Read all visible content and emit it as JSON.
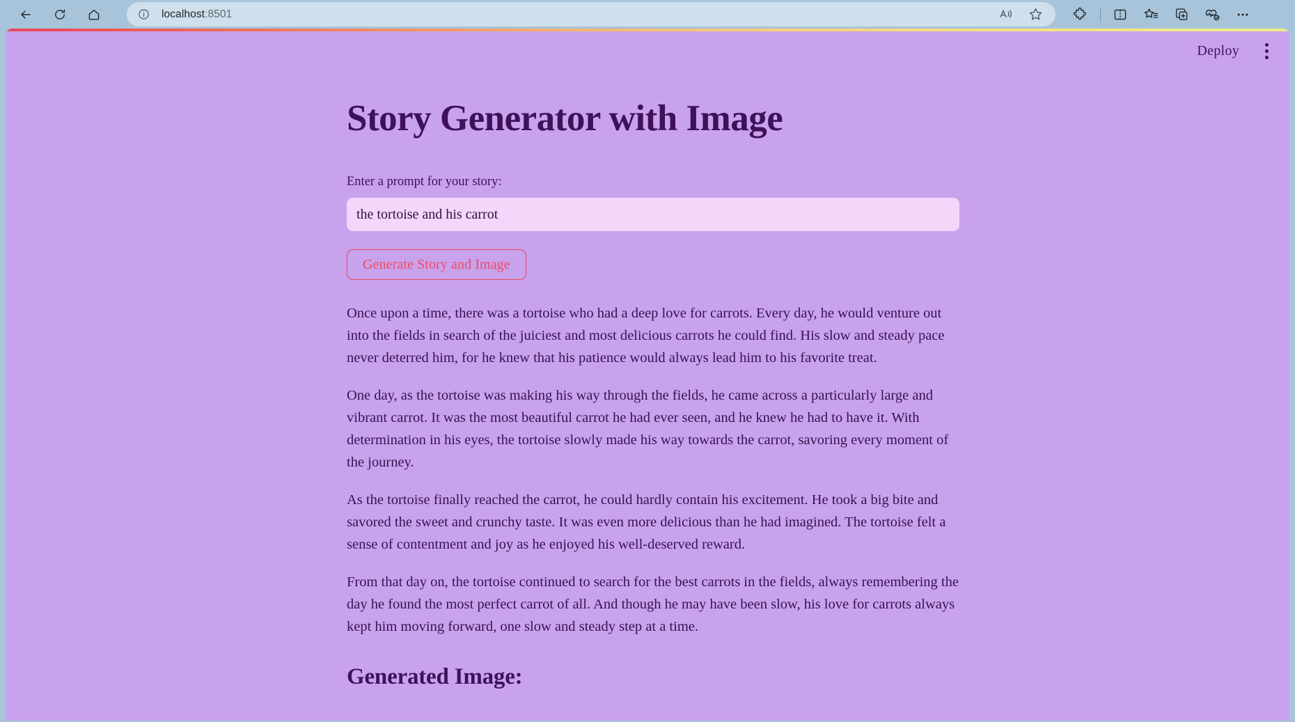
{
  "browser": {
    "back_icon": "back-arrow-icon",
    "reload_icon": "reload-icon",
    "home_icon": "home-icon",
    "site_info_icon": "site-info-icon",
    "url_host": "localhost",
    "url_port": ":8501",
    "read_aloud_icon": "read-aloud-icon",
    "favorite_icon": "star-icon",
    "extensions_icon": "puzzle-extensions-icon",
    "split_screen_icon": "split-screen-icon",
    "favorites_icon": "favorites-star-list-icon",
    "collections_icon": "collections-icon",
    "browser_essentials_icon": "browser-essentials-icon",
    "settings_icon": "ellipsis-settings-icon"
  },
  "app": {
    "deploy_label": "Deploy",
    "menu_icon": "kebab-menu-icon",
    "title": "Story Generator with Image",
    "prompt_label": "Enter a prompt for your story:",
    "prompt_value": "the tortoise and his carrot",
    "prompt_placeholder": "",
    "generate_button": "Generate Story and Image",
    "story_paragraphs": [
      "Once upon a time, there was a tortoise who had a deep love for carrots. Every day, he would venture out into the fields in search of the juiciest and most delicious carrots he could find. His slow and steady pace never deterred him, for he knew that his patience would always lead him to his favorite treat.",
      "One day, as the tortoise was making his way through the fields, he came across a particularly large and vibrant carrot. It was the most beautiful carrot he had ever seen, and he knew he had to have it. With determination in his eyes, the tortoise slowly made his way towards the carrot, savoring every moment of the journey.",
      "As the tortoise finally reached the carrot, he could hardly contain his excitement. He took a big bite and savored the sweet and crunchy taste. It was even more delicious than he had imagined. The tortoise felt a sense of contentment and joy as he enjoyed his well-deserved reward.",
      "From that day on, the tortoise continued to search for the best carrots in the fields, always remembering the day he found the most perfect carrot of all. And though he may have been slow, his love for carrots always kept him moving forward, one slow and steady step at a time."
    ],
    "generated_image_heading": "Generated Image:"
  },
  "colors": {
    "page_background": "#c9a2ee",
    "browser_chrome": "#a8c4da",
    "title_purple": "#3e1159",
    "input_background": "#f2d7fb",
    "button_accent": "#e8455a",
    "gradient_start": "#e8455f",
    "gradient_end": "#eeee84"
  }
}
